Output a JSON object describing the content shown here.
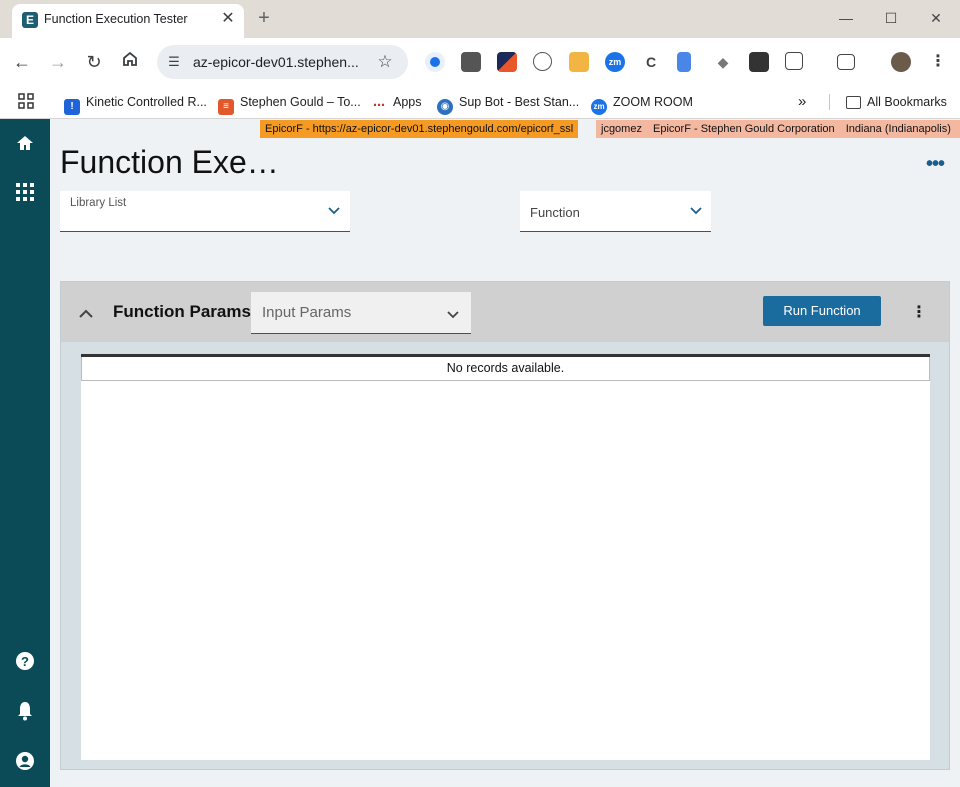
{
  "browser": {
    "tab_title": "Function Execution Tester",
    "tab_favicon": "E",
    "tab_close": "✕",
    "new_tab": "+",
    "window_controls": {
      "minimize": "—",
      "maximize": "☐",
      "close": "✕"
    },
    "url": "az-epicor-dev01.stephen...",
    "extensions": [
      "zm"
    ],
    "bookmarks": [
      {
        "label": "Kinetic Controlled R...",
        "icon": "exclamation-icon"
      },
      {
        "label": "Stephen Gould – To...",
        "icon": "todoist-icon"
      },
      {
        "label": "Apps",
        "icon": "apps-grid-icon"
      },
      {
        "label": "Sup Bot - Best Stan...",
        "icon": "robot-icon"
      },
      {
        "label": "ZOOM ROOM",
        "icon": "zoom-icon"
      }
    ],
    "bookmarks_overflow": "»",
    "all_bookmarks": "All Bookmarks"
  },
  "env": {
    "left": "EpicorF -   https://az-epicor-dev01.stephengould.com/epicorf_ssl",
    "user": "jcgomez",
    "company": "EpicorF - Stephen Gould Corporation",
    "site": "Indiana (Indianapolis)"
  },
  "page": {
    "title": "Function Exe…",
    "library_list_label": "Library List",
    "function_label": "Function"
  },
  "panel": {
    "title": "Function Params",
    "params_dropdown": "Input Params",
    "run_button": "Run Function",
    "empty_message": "No records available."
  },
  "colors": {
    "sidebar": "#0a4b57",
    "accent": "#1a6c9e",
    "env_orange": "#f59a23",
    "env_salmon": "#f4b8a0"
  }
}
